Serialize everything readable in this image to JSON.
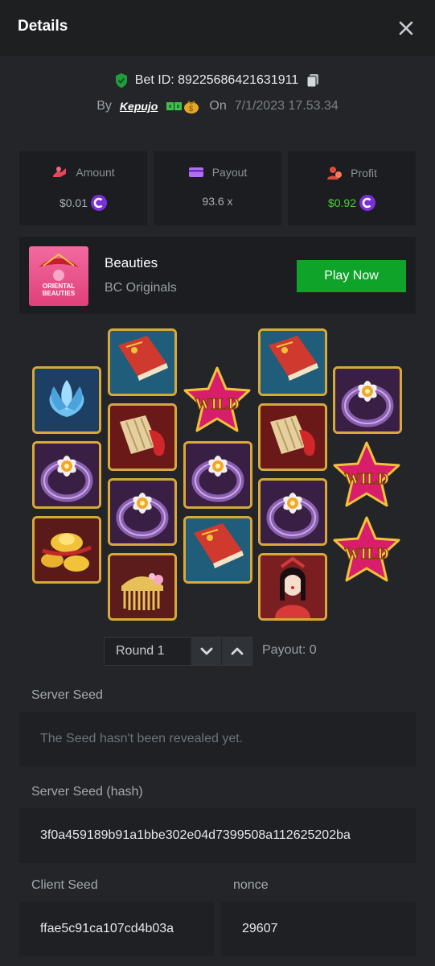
{
  "header": {
    "title": "Details"
  },
  "bet": {
    "id_text": "Bet ID: 89225686421631911",
    "by_label": "By",
    "username": "Kepujo",
    "on_label": "On",
    "date": "7/1/2023 17.53.34"
  },
  "stats": [
    {
      "label": "Amount",
      "value": "$0.01",
      "icon": "bet-hand-icon",
      "color": "#e8465a"
    },
    {
      "label": "Payout",
      "value": "93.6 x",
      "icon": "card-icon",
      "color": "#b46ef5"
    },
    {
      "label": "Profit",
      "value": "$0.92",
      "icon": "profit-person-icon",
      "color": "#e04a3a"
    }
  ],
  "game": {
    "name": "Beauties",
    "provider": "BC Originals",
    "play_label": "Play Now",
    "thumb_line1": "ORIENTAL",
    "thumb_line2": "BEAUTIES"
  },
  "reels": {
    "wild_text": "WILD",
    "symbols": [
      [
        "lotus",
        "ring",
        "gold"
      ],
      [
        "book",
        "fan",
        "ring",
        "comb"
      ],
      [
        "wild",
        "ring",
        "book"
      ],
      [
        "book",
        "fan",
        "ring",
        "lady"
      ],
      [
        "ring",
        "wild",
        "wild"
      ]
    ]
  },
  "round": {
    "label": "Round 1",
    "payout": "Payout: 0"
  },
  "seeds": {
    "server_label": "Server Seed",
    "server_placeholder": "The Seed hasn't been revealed yet.",
    "hash_label": "Server Seed (hash)",
    "hash_value": "3f0a459189b91a1bbe302e04d7399508a112625202ba",
    "client_label": "Client Seed",
    "client_value": "ffae5c91ca107cd4b03a",
    "nonce_label": "nonce",
    "nonce_value": "29607"
  },
  "colors": {
    "accent_green": "#10a32a",
    "profit_green": "#4fcf39",
    "tile_border": "#d7a93a",
    "coin_purple": "#7b2fd6"
  }
}
